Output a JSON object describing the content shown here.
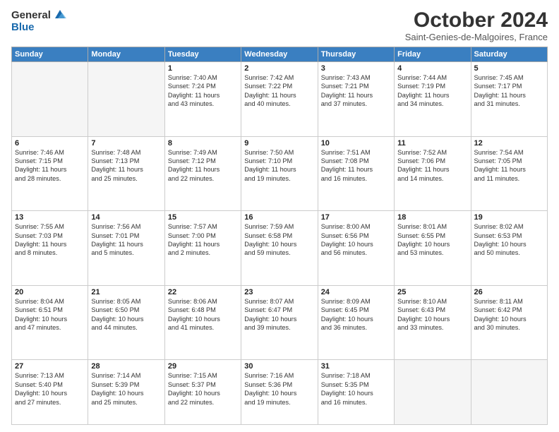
{
  "logo": {
    "general": "General",
    "blue": "Blue"
  },
  "header": {
    "title": "October 2024",
    "subtitle": "Saint-Genies-de-Malgoires, France"
  },
  "weekdays": [
    "Sunday",
    "Monday",
    "Tuesday",
    "Wednesday",
    "Thursday",
    "Friday",
    "Saturday"
  ],
  "weeks": [
    [
      {
        "day": "",
        "info": ""
      },
      {
        "day": "",
        "info": ""
      },
      {
        "day": "1",
        "info": "Sunrise: 7:40 AM\nSunset: 7:24 PM\nDaylight: 11 hours\nand 43 minutes."
      },
      {
        "day": "2",
        "info": "Sunrise: 7:42 AM\nSunset: 7:22 PM\nDaylight: 11 hours\nand 40 minutes."
      },
      {
        "day": "3",
        "info": "Sunrise: 7:43 AM\nSunset: 7:21 PM\nDaylight: 11 hours\nand 37 minutes."
      },
      {
        "day": "4",
        "info": "Sunrise: 7:44 AM\nSunset: 7:19 PM\nDaylight: 11 hours\nand 34 minutes."
      },
      {
        "day": "5",
        "info": "Sunrise: 7:45 AM\nSunset: 7:17 PM\nDaylight: 11 hours\nand 31 minutes."
      }
    ],
    [
      {
        "day": "6",
        "info": "Sunrise: 7:46 AM\nSunset: 7:15 PM\nDaylight: 11 hours\nand 28 minutes."
      },
      {
        "day": "7",
        "info": "Sunrise: 7:48 AM\nSunset: 7:13 PM\nDaylight: 11 hours\nand 25 minutes."
      },
      {
        "day": "8",
        "info": "Sunrise: 7:49 AM\nSunset: 7:12 PM\nDaylight: 11 hours\nand 22 minutes."
      },
      {
        "day": "9",
        "info": "Sunrise: 7:50 AM\nSunset: 7:10 PM\nDaylight: 11 hours\nand 19 minutes."
      },
      {
        "day": "10",
        "info": "Sunrise: 7:51 AM\nSunset: 7:08 PM\nDaylight: 11 hours\nand 16 minutes."
      },
      {
        "day": "11",
        "info": "Sunrise: 7:52 AM\nSunset: 7:06 PM\nDaylight: 11 hours\nand 14 minutes."
      },
      {
        "day": "12",
        "info": "Sunrise: 7:54 AM\nSunset: 7:05 PM\nDaylight: 11 hours\nand 11 minutes."
      }
    ],
    [
      {
        "day": "13",
        "info": "Sunrise: 7:55 AM\nSunset: 7:03 PM\nDaylight: 11 hours\nand 8 minutes."
      },
      {
        "day": "14",
        "info": "Sunrise: 7:56 AM\nSunset: 7:01 PM\nDaylight: 11 hours\nand 5 minutes."
      },
      {
        "day": "15",
        "info": "Sunrise: 7:57 AM\nSunset: 7:00 PM\nDaylight: 11 hours\nand 2 minutes."
      },
      {
        "day": "16",
        "info": "Sunrise: 7:59 AM\nSunset: 6:58 PM\nDaylight: 10 hours\nand 59 minutes."
      },
      {
        "day": "17",
        "info": "Sunrise: 8:00 AM\nSunset: 6:56 PM\nDaylight: 10 hours\nand 56 minutes."
      },
      {
        "day": "18",
        "info": "Sunrise: 8:01 AM\nSunset: 6:55 PM\nDaylight: 10 hours\nand 53 minutes."
      },
      {
        "day": "19",
        "info": "Sunrise: 8:02 AM\nSunset: 6:53 PM\nDaylight: 10 hours\nand 50 minutes."
      }
    ],
    [
      {
        "day": "20",
        "info": "Sunrise: 8:04 AM\nSunset: 6:51 PM\nDaylight: 10 hours\nand 47 minutes."
      },
      {
        "day": "21",
        "info": "Sunrise: 8:05 AM\nSunset: 6:50 PM\nDaylight: 10 hours\nand 44 minutes."
      },
      {
        "day": "22",
        "info": "Sunrise: 8:06 AM\nSunset: 6:48 PM\nDaylight: 10 hours\nand 41 minutes."
      },
      {
        "day": "23",
        "info": "Sunrise: 8:07 AM\nSunset: 6:47 PM\nDaylight: 10 hours\nand 39 minutes."
      },
      {
        "day": "24",
        "info": "Sunrise: 8:09 AM\nSunset: 6:45 PM\nDaylight: 10 hours\nand 36 minutes."
      },
      {
        "day": "25",
        "info": "Sunrise: 8:10 AM\nSunset: 6:43 PM\nDaylight: 10 hours\nand 33 minutes."
      },
      {
        "day": "26",
        "info": "Sunrise: 8:11 AM\nSunset: 6:42 PM\nDaylight: 10 hours\nand 30 minutes."
      }
    ],
    [
      {
        "day": "27",
        "info": "Sunrise: 7:13 AM\nSunset: 5:40 PM\nDaylight: 10 hours\nand 27 minutes."
      },
      {
        "day": "28",
        "info": "Sunrise: 7:14 AM\nSunset: 5:39 PM\nDaylight: 10 hours\nand 25 minutes."
      },
      {
        "day": "29",
        "info": "Sunrise: 7:15 AM\nSunset: 5:37 PM\nDaylight: 10 hours\nand 22 minutes."
      },
      {
        "day": "30",
        "info": "Sunrise: 7:16 AM\nSunset: 5:36 PM\nDaylight: 10 hours\nand 19 minutes."
      },
      {
        "day": "31",
        "info": "Sunrise: 7:18 AM\nSunset: 5:35 PM\nDaylight: 10 hours\nand 16 minutes."
      },
      {
        "day": "",
        "info": ""
      },
      {
        "day": "",
        "info": ""
      }
    ]
  ]
}
